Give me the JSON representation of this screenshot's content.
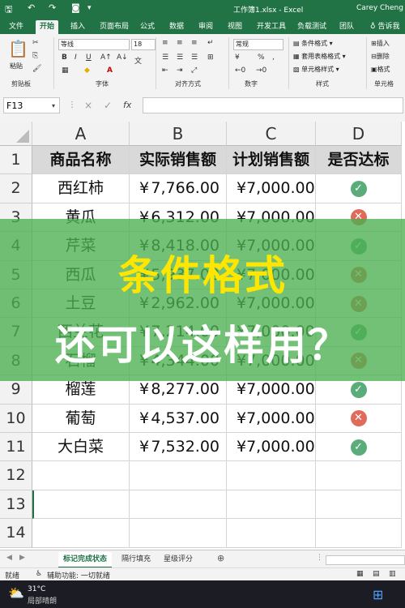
{
  "titlebar": {
    "file": "工作簿1.xlsx - Excel",
    "user": "Carey Cheng",
    "save_icon": "save-icon",
    "undo_icon": "undo-icon",
    "redo_icon": "redo-icon"
  },
  "menu": {
    "tabs": [
      "文件",
      "开始",
      "插入",
      "页面布局",
      "公式",
      "数据",
      "审阅",
      "视图",
      "开发工具",
      "负载测试",
      "团队",
      "告诉我"
    ]
  },
  "ribbon": {
    "font_name": "等线",
    "font_size": "18",
    "number_format": "常规",
    "paste": "粘贴",
    "groups": [
      "剪贴板",
      "字体",
      "对齐方式",
      "数字",
      "样式",
      "单元格"
    ],
    "style_items": [
      "条件格式",
      "套用表格格式",
      "单元格样式"
    ],
    "cell_items": [
      "插入",
      "删除",
      "格式"
    ],
    "wen": "文"
  },
  "formula_bar": {
    "name_box": "F13",
    "fx": "fx",
    "cancel": "×",
    "confirm": "✓"
  },
  "columns": [
    "A",
    "B",
    "C",
    "D"
  ],
  "rows": [
    "1",
    "2",
    "3",
    "4",
    "5",
    "6",
    "7",
    "8",
    "9",
    "10",
    "11",
    "12",
    "13",
    "14"
  ],
  "table": {
    "headers": [
      "商品名称",
      "实际销售额",
      "计划销售额",
      "是否达标"
    ],
    "currency": "¥",
    "data": [
      {
        "name": "西红柿",
        "actual": "7,766.00",
        "plan": "7,000.00",
        "ok": true
      },
      {
        "name": "黄瓜",
        "actual": "6,312.00",
        "plan": "7,000.00",
        "ok": false
      },
      {
        "name": "芹菜",
        "actual": "8,418.00",
        "plan": "7,000.00",
        "ok": true
      },
      {
        "name": "西瓜",
        "actual": "5,937.00",
        "plan": "7,000.00",
        "ok": false
      },
      {
        "name": "土豆",
        "actual": "2,962.00",
        "plan": "7,000.00",
        "ok": false
      },
      {
        "name": "西兰花",
        "actual": "7,214.00",
        "plan": "7,000.00",
        "ok": true
      },
      {
        "name": "石榴",
        "actual": "4,344.00",
        "plan": "7,000.00",
        "ok": false
      },
      {
        "name": "榴莲",
        "actual": "8,277.00",
        "plan": "7,000.00",
        "ok": true
      },
      {
        "name": "葡萄",
        "actual": "4,537.00",
        "plan": "7,000.00",
        "ok": false
      },
      {
        "name": "大白菜",
        "actual": "7,532.00",
        "plan": "7,000.00",
        "ok": true
      }
    ]
  },
  "overlay": {
    "line1": "条件格式",
    "line2": "还可以这样用？"
  },
  "sheet_tabs": [
    "标记完成状态",
    "隔行填充",
    "星级评分"
  ],
  "status": {
    "mode": "就绪",
    "accessibility": "辅助功能: 一切就绪"
  },
  "taskbar": {
    "temperature": "31°C",
    "weather": "局部晴朗"
  },
  "colors": {
    "excel_green": "#217346",
    "ok": "#5aac7b",
    "fail": "#e06b5a",
    "overlay": "#4caf50",
    "overlay_title": "#ffe600"
  }
}
